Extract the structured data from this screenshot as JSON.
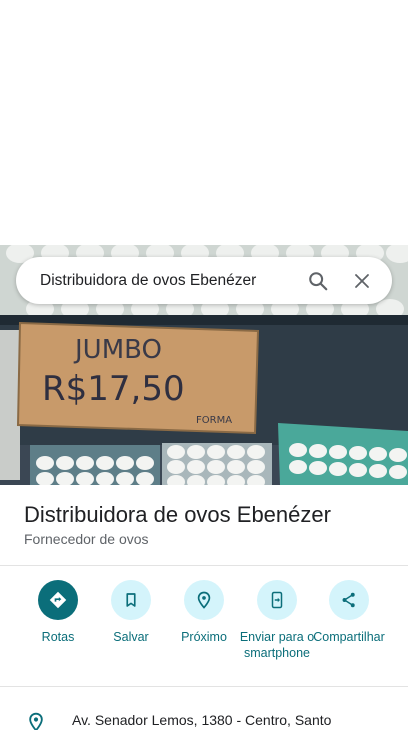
{
  "search": {
    "query": "Distribuidora de ovos Ebenézer"
  },
  "photo": {
    "sign_line1": "JUMBO",
    "sign_line2": "R$17,50",
    "sign_small": "FORMA"
  },
  "place": {
    "name": "Distribuidora de ovos Ebenézer",
    "category": "Fornecedor de ovos"
  },
  "actions": [
    {
      "label": "Rotas",
      "icon": "directions-icon"
    },
    {
      "label": "Salvar",
      "icon": "bookmark-icon"
    },
    {
      "label": "Próximo",
      "icon": "nearby-icon"
    },
    {
      "label": "Enviar para o smartphone",
      "icon": "send-to-phone-icon"
    },
    {
      "label": "Compartilhar",
      "icon": "share-icon"
    }
  ],
  "address": {
    "text": "Av. Senador Lemos, 1380 - Centro, Santo"
  },
  "colors": {
    "accent": "#0b6e7a",
    "action_bg": "#d4f4fb"
  }
}
